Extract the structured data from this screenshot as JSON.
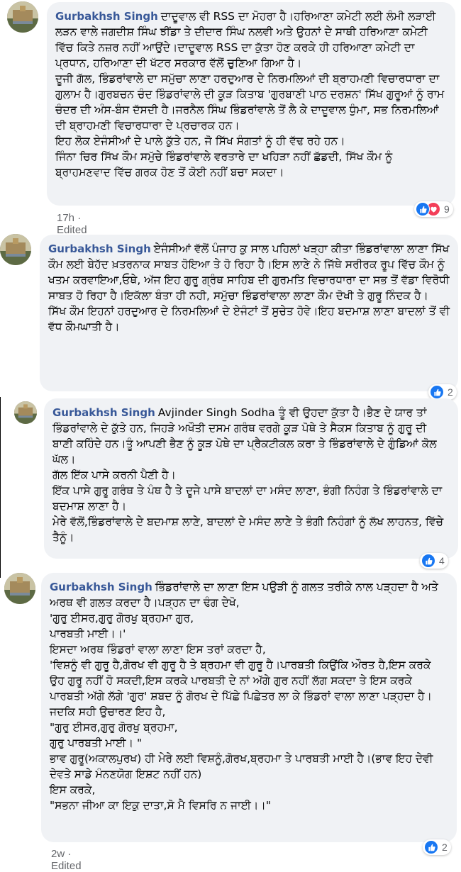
{
  "comments": [
    {
      "author": "Gurbakhsh Singh",
      "text": "ਦਾਦੂਵਾਲ ਵੀ RSS ਦਾ ਮੋਹਰਾ ਹੈ।ਹਰਿਆਣਾ ਕਮੇਟੀ ਲਈ ਲੰਮੀ ਲੜਾਈ ਲੜਨ ਵਾਲੇ ਜਗਦੀਸ਼ ਸਿੰਘ ਝੀਂਡਾ ਤੇ ਦੀਦਾਰ ਸਿੰਘ ਨਲਵੀ ਅਤੇ ਉਹਨਾਂ ਦੇ ਸਾਥੀ ਹਰਿਆਣਾ ਕਮੇਟੀ ਵਿੱਚ ਕਿਤੇ ਨਜ਼ਰ ਨਹੀਂ ਆਉਂਦੇ।ਦਾਦੂਵਾਲ RSS ਦਾ ਕੁੱਤਾ ਹੋਣ ਕਰਕੇ ਹੀ ਹਰਿਆਣਾ ਕਮੇਟੀ ਦਾ ਪ੍ਰਧਾਨ, ਹਰਿਆਣਾ ਦੀ ਖੱਟਰ ਸਰਕਾਰ ਵੱਲੋਂ ਚੁਣਿਆ ਗਿਆ ਹੈ।\nਦੂਜੀ ਗੱਲ, ਭਿੰਡਰਾਂਵਾਲੇ ਦਾ ਸਮੁੱਚਾ ਲਾਣਾ ਹਰਦੁਆਰ ਦੇ ਨਿਰਮਲਿਆਂ ਦੀ ਬ੍ਰਾਹਮਣੀ ਵਿਚਾਰਧਾਰਾ ਦਾ ਗੁਲਾਮ ਹੈ।ਗੁਰਬਚਨ ਚੰਦ ਭਿੰਡਰਾਂਵਾਲੇ ਦੀ ਕੂੜ ਕਿਤਾਬ 'ਗੁਰਬਾਣੀ ਪਾਠ ਦਰਸ਼ਨ' ਸਿੱਖ ਗੁਰੂਆਂ ਨੂੰ ਰਾਮ ਚੰਦਰ ਦੀ ਅੰਸ-ਬੰਸ ਦੱਸਦੀ ਹੈ।ਜਰਨੈਲ ਸਿੰਘ ਭਿੰਡਰਾਂਵਾਲੇ ਤੋਂ ਲੈ ਕੇ ਦਾਦੂਵਾਲ ਧੁੰਮਾ, ਸਭ ਨਿਰਮਲਿਆਂ ਦੀ ਬ੍ਰਾਹਮਣੀ ਵਿਚਾਰਧਾਰਾ ਦੇ ਪ੍ਰਚਾਰਕ ਹਨ।\nਇਹ ਲੋਕ ਏਜੰਸੀਆਂ ਦੇ ਪਾਲੇ ਕੁੱਤੇ ਹਨ, ਜੋ ਸਿੱਖ ਸੰਗਤਾਂ ਨੂੰ ਹੀ ਵੱਢ ਰਹੇ ਹਨ।\nਜਿੰਨਾ ਚਿਰ ਸਿੱਖ ਕੌਮ ਸਮੁੱਚੇ ਭਿੰਡਰਾਂਵਾਲੇ ਵਰਤਾਰੇ ਦਾ ਖਹਿੜਾ ਨਹੀਂ ਛੱਡਦੀ, ਸਿੱਖ ਕੌਮ ਨੂੰ ਬ੍ਰਾਹਮਣਵਾਦ ਵਿੱਚ ਗਰਕ ਹੋਣ ਤੋਂ ਕੋਈ ਨਹੀਂ ਬਚਾ ਸਕਦਾ।",
      "time": "17h",
      "edited": "Edited",
      "reaction_count": "9"
    },
    {
      "author": "Gurbakhsh Singh",
      "text": "ਏਜੰਸੀਆਂ ਵੱਲੋਂ ਪੰਜਾਹ ਕੁ ਸਾਲ ਪਹਿਲਾਂ ਖੜ੍ਹਾ ਕੀਤਾ ਭਿੰਡਰਾਂਵਾਲਾ ਲਾਣਾ ਸਿੱਖ ਕੌਮ ਲਈ ਬੇਹੱਦ ਖ਼ਤਰਨਾਕ ਸਾਬਤ ਹੋਇਆ ਤੇ ਹੋ ਰਿਹਾ ਹੈ।ਇਸ ਲਾਣੇ ਨੇ ਜਿੱਥੇ ਸਰੀਰਕ ਰੂਪ ਵਿੱਚ ਕੌਮ ਨੂੰ ਖਤਮ ਕਰਵਾਇਆ,ਓਥੇ, ਅੱਜ ਇਹ ਗੁਰੂ ਗ੍ਰੰਥ ਸਾਹਿਬ ਦੀ ਗੁਰਮਤਿ ਵਿਚਾਰਧਾਰਾ ਦਾ ਸਭ ਤੋਂ ਵੱਡਾ ਵਿਰੋਧੀ ਸਾਬਤ ਹੋ ਰਿਹਾ ਹੈ।ਇਕੱਲਾ ਬੰਤਾ ਹੀ ਨਹੀ, ਸਮੁੱਚਾ ਭਿੰਡਰਾਂਵਾਲਾ ਲਾਣਾ ਕੌਮ ਦੋਖੀ ਤੇ ਗੁਰੂ ਨਿੰਦਕ ਹੈ।\nਸਿੱਖ ਕੌਮ ਇਹਨਾਂ ਹਰਦੁਆਰ ਦੇ ਨਿਰਮਲਿਆਂ ਦੇ ਏਜੰਟਾਂ ਤੋਂ ਸੁਚੇਤ ਹੋਵੇ।ਇਹ ਬਦਮਾਸ਼ ਲਾਣਾ ਬਾਦਲਾਂ ਤੋਂ ਵੀ ਵੱਧ ਕੌਮਘਾਤੀ ਹੈ।",
      "reaction_count": "2"
    },
    {
      "author": "Gurbakhsh Singh",
      "text": "Avjinder Singh Sodha ਤੂੰ ਵੀ ਉਹਦਾ ਕੁੱਤਾ ਹੈ।ਭੈਣ ਦੇ ਯਾਰ ਤਾਂ ਭਿੰਡਰਾਂਵਾਲੇ ਦੇ ਕੁੱਤੇ ਹਨ, ਜਿਹੜੇ ਅਖੌਤੀ ਦਸਮ ਗਰੰਥ ਵਰਗੇ ਕੂੜ ਪੋਥੇ ਤੇ ਸੈਕਸ ਕਿਤਾਬ ਨੂੰ ਗੁਰੂ ਦੀ ਬਾਣੀ ਕਹਿੰਦੇ ਹਨ।ਤੂੰ ਆਪਣੀ ਭੈਣ ਨੂੰ ਕੂੜ ਪੋਥੇ ਦਾ ਪ੍ਰੈਕਟੀਕਲ ਕਰਾ ਤੇ ਭਿੰਡਰਾਂਵਾਲੇ ਦੇ ਗੁੰਡਿਆਂ ਕੋਲ ਘੱਲ।\nਗੱਲ ਇੱਕ ਪਾਸੇ ਕਰਨੀ ਪੈਣੀ ਹੈ।\nਇੱਕ ਪਾਸੇ ਗੁਰੂ ਗਰੰਥ ਤੇ ਪੰਥ ਹੈ ਤੇ ਦੂਜੇ ਪਾਸੇ ਬਾਦਲਾਂ ਦਾ ਮਸੰਦ ਲਾਣਾ, ਭੰਗੀ ਨਿਹੰਗ ਤੇ ਭਿੰਡਰਾਂਵਾਲੇ ਦਾ ਬਦਮਾਸ਼ ਲਾਣਾ ਹੈ।\nਮੇਰੇ ਵੱਲੋਂ,ਭਿੰਡਰਾਂਵਾਲੇ ਦੇ ਬਦਮਾਸ਼ ਲਾਣੇ, ਬਾਦਲਾਂ ਦੇ ਮਸੰਦ ਲਾਣੇ ਤੇ ਭੰਗੀ ਨਿਹੰਗਾਂ ਨੂੰ ਲੱਖ ਲਾਹਨਤ, ਵਿੱਚੇ ਤੈਨੂੰ।",
      "reaction_count": "4"
    },
    {
      "author": "Gurbakhsh Singh",
      "text": "ਭਿੰਡਰਾਂਵਾਲੇ ਦਾ ਲਾਣਾ ਇਸ ਪਉੜੀ ਨੂੰ ਗਲਤ ਤਰੀਕੇ ਨਾਲ ਪੜ੍ਹਦਾ ਹੈ ਅਤੇ ਅਰਥ ਵੀ ਗਲਤ ਕਰਦਾ ਹੈ।ਪੜ੍ਹਨ ਦਾ ਢੰਗ ਦੇਖੋ,\n'ਗੁਰੁ ਈਸਰ,ਗੁਰੁ ਗੋਰਖੁ ਬ੍ਰਹਮਾ ਗੁਰ,\nਪਾਰਬਤੀ ਮਾਈ।।'\nਇਸਦਾ ਅਰਥ ਭਿੰਡਰਾਂ ਵਾਲਾ ਲਾਣਾ ਇਸ ਤਰਾਂ ਕਰਦਾ ਹੈ,\n'ਵਿਸ਼ਨੂੰ ਵੀ ਗੁਰੂ ਹੈ,ਗੋਰਖ ਵੀ ਗੁਰੂ ਹੈ ਤੇ ਬ੍ਰਹਮਾ ਵੀ ਗੁਰੂ ਹੈ।ਪਾਰਬਤੀ ਕਿਉਂਕਿ ਔਰਤ ਹੈ,ਇਸ ਕਰਕੇ ਉਹ ਗੁਰੂ ਨਹੀਂ ਹੋ ਸਕਦੀ,ਇਸ ਕਰਕੇ ਪਾਰਬਤੀ ਦੇ ਨਾਂ ਅੱਗੇ ਗੁਰ ਨਹੀਂ ਲੱਗ ਸਕਦਾ ਤੇ ਇਸ ਕਰਕੇ ਪਾਰਬਤੀ ਅੱਗੇ ਲੱਗੇ 'ਗੁਰ' ਸ਼ਬਦ ਨੂੰ ਗੋਰਖ ਦੇ ਪਿੱਛੇ ਪਿਛੇਤਰ ਲਾ ਕੇ ਭਿੰਡਰਾਂ ਵਾਲਾ ਲਾਣਾ ਪੜ੍ਹਦਾ ਹੈ।\nਜਦਕਿ ਸਹੀ ਉਚਾਰਣ ਇਹ ਹੈ,\n\"ਗੁਰੁ ਈਸਰ,ਗੁਰੁ ਗੋਰਖੁ ਬ੍ਰਹਮਾ,\nਗੁਰੁ ਪਾਰਬਤੀ ਮਾਈ। \"\nਭਾਵ ਗੁਰੂ(ਅਕਾਲਪੁਰਖ) ਹੀ ਮੇਰੇ ਲਈ ਵਿਸ਼ਨੂੰ,ਗੋਰਖ,ਬ੍ਰਹਮਾ ਤੇ ਪਾਰਬਤੀ ਮਾਈ ਹੈ।(ਭਾਵ ਇਹ ਦੇਵੀ ਦੇਵਤੇ ਸਾਡੇ ਮੰਨਣਯੋਗ ਇਸ਼ਟ ਨਹੀਂ ਹਨ)\nਇਸ ਕਰਕੇ,\n\"ਸਭਨਾ ਜੀਆ ਕਾ ਇਕੁ ਦਾਤਾ,ਸੋ ਮੈ ਵਿਸਰਿ ਨ ਜਾਈ।।\"",
      "time": "2w",
      "edited": "Edited",
      "reaction_count": "2"
    }
  ],
  "meta_separator": "·",
  "colors": {
    "author": "#385898",
    "bubble": "#f0f2f5",
    "meta": "#65676b",
    "like": "#1877f2",
    "love": "#f33e58"
  },
  "icons": {
    "like": "thumbs-up-icon",
    "love": "heart-icon"
  }
}
